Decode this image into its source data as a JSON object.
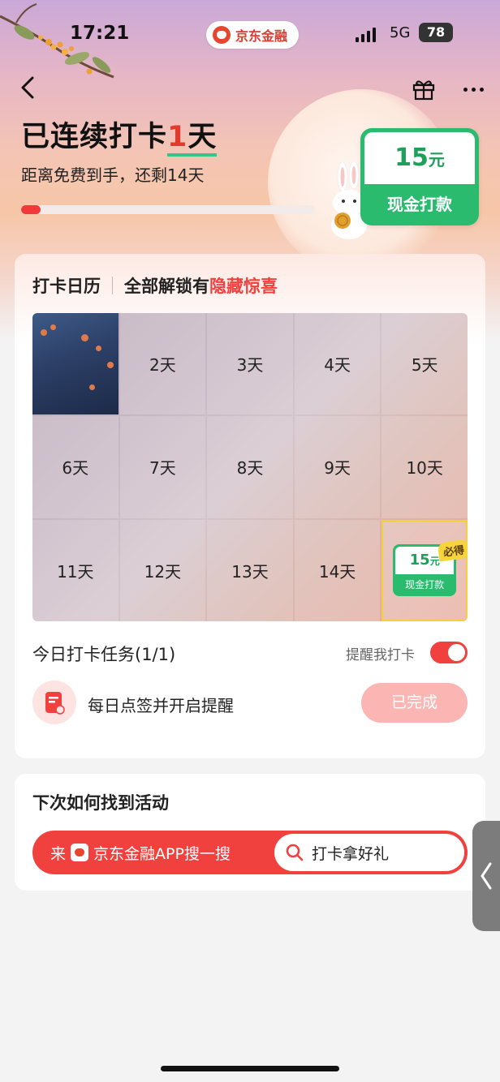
{
  "status_bar": {
    "time": "17:21",
    "brand": "京东金融",
    "network": "5G",
    "battery": "78"
  },
  "header": {
    "icons": [
      "back-icon",
      "gift-icon",
      "more-icon"
    ]
  },
  "streak": {
    "title_prefix": "已连续打卡",
    "days": "1",
    "title_suffix": "天",
    "remaining_text": "距离免费到手，还剩14天",
    "progress_fraction": 0.066
  },
  "reward": {
    "amount": "15",
    "unit": "元",
    "label": "现金打款"
  },
  "calendar": {
    "title": "打卡日历",
    "subtitle": "全部解锁有",
    "subtitle_highlight": "隐藏惊喜",
    "days": [
      "2天",
      "3天",
      "4天",
      "5天",
      "6天",
      "7天",
      "8天",
      "9天",
      "10天",
      "11天",
      "12天",
      "13天",
      "14天"
    ],
    "final_reward": {
      "amount": "15",
      "unit": "元",
      "label": "现金打款",
      "badge": "必得"
    }
  },
  "task": {
    "title": "今日打卡任务(1/1)",
    "remind_label": "提醒我打卡",
    "remind_on": true,
    "name": "每日点签并开启提醒",
    "button": "已完成"
  },
  "find": {
    "title": "下次如何找到活动",
    "prefix_1": "来",
    "prefix_2": "京东金融APP搜一搜",
    "search_text": "打卡拿好礼"
  },
  "colors": {
    "accent_red": "#f0413f",
    "reward_green": "#2bbb6f",
    "badge_yellow": "#f7d43a"
  }
}
